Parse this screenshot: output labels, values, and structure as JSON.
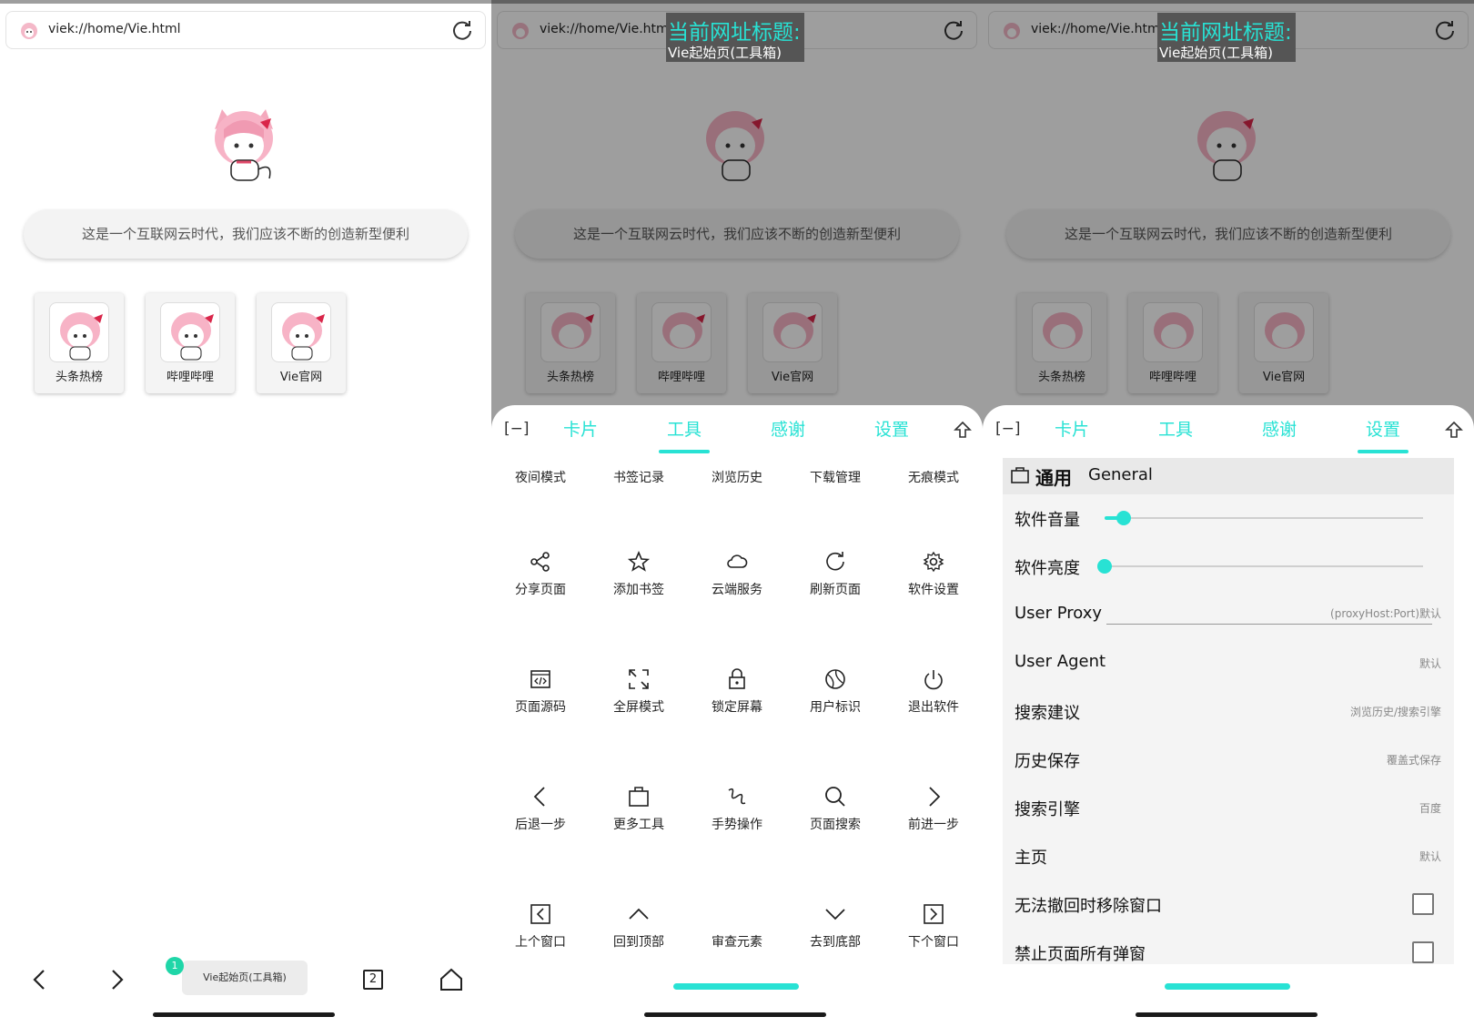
{
  "colors": {
    "accent": "#28e2d4",
    "badge": "#1fd6a8"
  },
  "address": {
    "url": "viek://home/Vie.html"
  },
  "home": {
    "slogan": "这是一个互联网云时代，我们应该不断的创造新型便利",
    "cards": [
      {
        "label": "头条热榜",
        "icon": "mascot-icon"
      },
      {
        "label": "哔哩哔哩",
        "icon": "mascot-icon"
      },
      {
        "label": "Vie官网",
        "icon": "mascot-icon"
      }
    ]
  },
  "bottom_nav": {
    "tab_title": "Vie起始页(工具箱)",
    "tab_badge": "1",
    "tab_count": "2"
  },
  "tooltip": {
    "title": "当前网址标题:",
    "value": "Vie起始页(工具箱)"
  },
  "sheet": {
    "collapse": "[−]",
    "tabs": [
      "卡片",
      "工具",
      "感谢",
      "设置"
    ]
  },
  "tools": {
    "row1": [
      "夜间模式",
      "书签记录",
      "浏览历史",
      "下载管理",
      "无痕模式"
    ],
    "items": [
      {
        "label": "分享页面",
        "icon": "share-icon"
      },
      {
        "label": "添加书签",
        "icon": "star-icon"
      },
      {
        "label": "云端服务",
        "icon": "cloud-icon"
      },
      {
        "label": "刷新页面",
        "icon": "refresh-icon"
      },
      {
        "label": "软件设置",
        "icon": "gear-icon"
      },
      {
        "label": "页面源码",
        "icon": "code-icon"
      },
      {
        "label": "全屏模式",
        "icon": "fullscreen-icon"
      },
      {
        "label": "锁定屏幕",
        "icon": "lock-icon"
      },
      {
        "label": "用户标识",
        "icon": "globe-icon"
      },
      {
        "label": "退出软件",
        "icon": "power-icon"
      },
      {
        "label": "后退一步",
        "icon": "chevron-left-icon"
      },
      {
        "label": "更多工具",
        "icon": "briefcase-icon"
      },
      {
        "label": "手势操作",
        "icon": "gesture-icon"
      },
      {
        "label": "页面搜索",
        "icon": "search-icon"
      },
      {
        "label": "前进一步",
        "icon": "chevron-right-icon"
      },
      {
        "label": "上个窗口",
        "icon": "prev-window-icon"
      },
      {
        "label": "回到顶部",
        "icon": "chevron-up-icon"
      },
      {
        "label": "审查元素",
        "icon": ""
      },
      {
        "label": "去到底部",
        "icon": "chevron-down-icon"
      },
      {
        "label": "下个窗口",
        "icon": "next-window-icon"
      }
    ]
  },
  "settings": {
    "section_zh": "通用",
    "section_en": "General",
    "volume_label": "软件音量",
    "volume_level": 0.06,
    "brightness_label": "软件亮度",
    "brightness_level": 0.0,
    "proxy_label": "User Proxy",
    "proxy_placeholder": "(proxyHost:Port)默认",
    "rows": [
      {
        "label": "User Agent",
        "value": "默认"
      },
      {
        "label": "搜索建议",
        "value": "浏览历史/搜索引擎"
      },
      {
        "label": "历史保存",
        "value": "覆盖式保存"
      },
      {
        "label": "搜索引擎",
        "value": "百度"
      },
      {
        "label": "主页",
        "value": "默认"
      }
    ],
    "check1_label": "无法撤回时移除窗口",
    "check2_label": "禁止页面所有弹窗"
  }
}
